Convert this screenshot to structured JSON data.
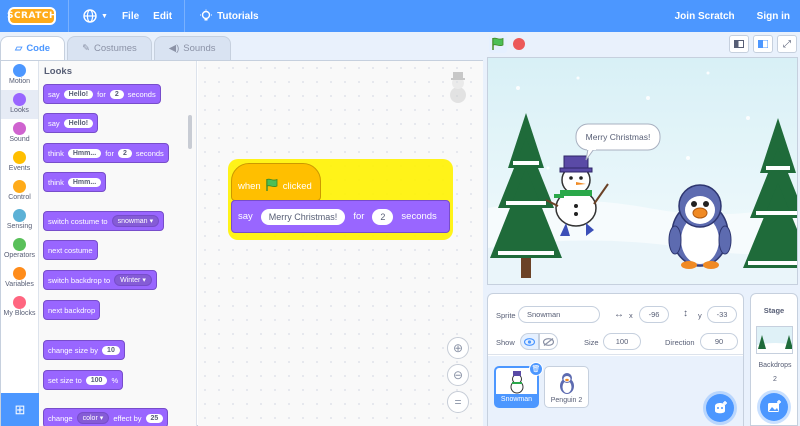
{
  "menubar": {
    "logo": "SCRATCH",
    "file": "File",
    "edit": "Edit",
    "tutorials": "Tutorials",
    "join": "Join Scratch",
    "signin": "Sign in"
  },
  "tabs": {
    "code": "Code",
    "costumes": "Costumes",
    "sounds": "Sounds"
  },
  "categories": [
    {
      "label": "Motion",
      "color": "#4c97ff"
    },
    {
      "label": "Looks",
      "color": "#9966ff"
    },
    {
      "label": "Sound",
      "color": "#cf63cf"
    },
    {
      "label": "Events",
      "color": "#ffbf00"
    },
    {
      "label": "Control",
      "color": "#ffab19"
    },
    {
      "label": "Sensing",
      "color": "#5cb1d6"
    },
    {
      "label": "Operators",
      "color": "#59c059"
    },
    {
      "label": "Variables",
      "color": "#ff8c1a"
    },
    {
      "label": "My Blocks",
      "color": "#ff6680"
    }
  ],
  "palette": {
    "title": "Looks",
    "say_for": {
      "say": "say",
      "msg": "Hello!",
      "for": "for",
      "secs": "2",
      "seconds": "seconds"
    },
    "say": {
      "say": "say",
      "msg": "Hello!"
    },
    "think_for": {
      "think": "think",
      "msg": "Hmm...",
      "for": "for",
      "secs": "2",
      "seconds": "seconds"
    },
    "think": {
      "think": "think",
      "msg": "Hmm..."
    },
    "switch_costume": {
      "label": "switch costume to",
      "value": "snowman"
    },
    "next_costume": "next costume",
    "switch_backdrop": {
      "label": "switch backdrop to",
      "value": "Winter"
    },
    "next_backdrop": "next backdrop",
    "change_size": {
      "label": "change size by",
      "value": "10"
    },
    "set_size": {
      "label": "set size to",
      "value": "100",
      "unit": "%"
    },
    "change_effect": {
      "change": "change",
      "effect": "color",
      "by": "effect by",
      "value": "25"
    }
  },
  "script": {
    "when": "when",
    "clicked": "clicked",
    "say": "say",
    "message": "Merry Christmas!",
    "for": "for",
    "secs": "2",
    "seconds": "seconds"
  },
  "stage": {
    "speech": "Merry Christmas!"
  },
  "sprite_info": {
    "sprite_label": "Sprite",
    "sprite_name": "Snowman",
    "x_label": "x",
    "x_value": "-96",
    "y_label": "y",
    "y_value": "-33",
    "show_label": "Show",
    "size_label": "Size",
    "size_value": "100",
    "direction_label": "Direction",
    "direction_value": "90"
  },
  "sprites": [
    {
      "name": "Snowman"
    },
    {
      "name": "Penguin 2"
    }
  ],
  "stage_pane": {
    "title": "Stage",
    "backdrops_label": "Backdrops",
    "backdrops_count": "2"
  },
  "colors": {
    "accent": "#4c97ff",
    "looks": "#9966ff",
    "events": "#ffbf00"
  }
}
